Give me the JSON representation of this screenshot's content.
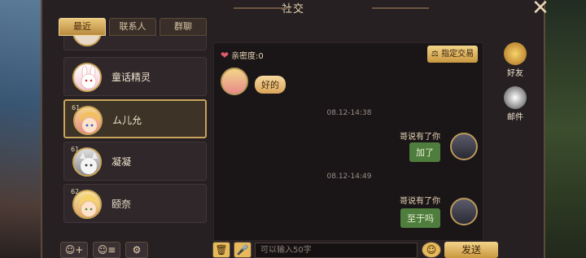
{
  "window": {
    "title": "社交"
  },
  "tabs": [
    {
      "label": "最近",
      "active": true
    },
    {
      "label": "联系人",
      "active": false
    },
    {
      "label": "群聊",
      "active": false
    }
  ],
  "contacts": [
    {
      "name": "",
      "level": ""
    },
    {
      "name": "童话精灵",
      "level": ""
    },
    {
      "name": "ム儿允",
      "level": "61",
      "selected": true
    },
    {
      "name": "凝凝",
      "level": "61"
    },
    {
      "name": "颐奈",
      "level": "62"
    }
  ],
  "chat": {
    "intimacy_label": "亲密度:0",
    "trade_button": "指定交易",
    "messages": [
      {
        "side": "left",
        "text": "好的"
      },
      {
        "timestamp": "08.12-14:38"
      },
      {
        "side": "right",
        "sender": "哥说有了你",
        "text": "加了"
      },
      {
        "timestamp": "08.12-14:49"
      },
      {
        "side": "right",
        "sender": "哥说有了你",
        "text": "至于吗"
      }
    ]
  },
  "side_nav": [
    {
      "label": "好友",
      "icon": "friend-icon"
    },
    {
      "label": "邮件",
      "icon": "mail-icon"
    }
  ],
  "input": {
    "placeholder": "可以输入50字"
  },
  "send_label": "发送",
  "colors": {
    "accent_gold": "#c9a45a",
    "bubble_green": "#4f7d3e"
  }
}
